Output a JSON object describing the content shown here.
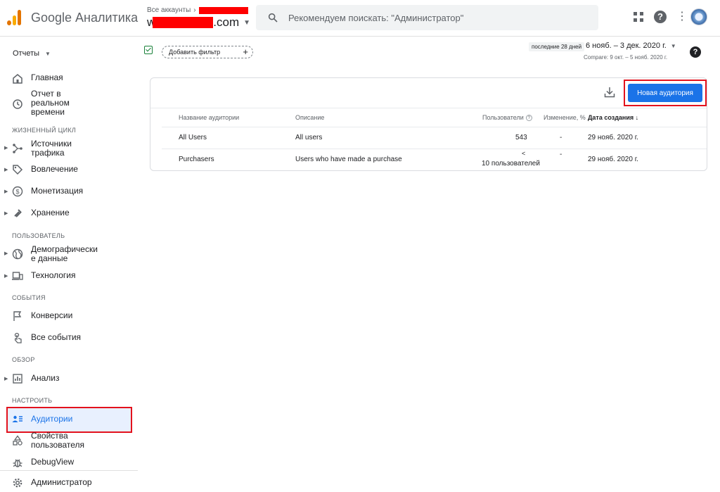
{
  "app": {
    "title": "Google Аналитика"
  },
  "account": {
    "breadcrumb": "Все аккаунты",
    "name_suffix": ".com"
  },
  "search": {
    "placeholder": "Рекомендуем поискать: \"Администратор\""
  },
  "sidebar": {
    "reports_label": "Отчеты",
    "items": {
      "home": "Главная",
      "realtime": "Отчет в реальном времени",
      "traffic": "Источники трафика",
      "engagement": "Вовлечение",
      "monetization": "Монетизация",
      "retention": "Хранение",
      "demographics": "Демографически е данные",
      "tech": "Технология",
      "conversions": "Конверсии",
      "all_events": "Все события",
      "analysis": "Анализ",
      "audiences": "Аудитории",
      "user_props": "Свойства пользователя",
      "debugview": "DebugView",
      "admin": "Администратор"
    },
    "sections": {
      "lifecycle": "ЖИЗНЕННЫЙ ЦИКЛ",
      "user": "ПОЛЬЗОВАТЕЛЬ",
      "events": "СОБЫТИЯ",
      "explore": "ОБЗОР",
      "configure": "НАСТРОИТЬ"
    }
  },
  "toolbar": {
    "add_filter": "Добавить фильтр",
    "date_tag": "последние 28 дней",
    "date_range": "6 нояб. – 3 дек. 2020 г.",
    "compare": "Compare: 9 окт. – 5 нояб. 2020 г."
  },
  "table": {
    "new_audience_button": "Новая аудитория",
    "headers": {
      "name": "Название аудитории",
      "description": "Описание",
      "users": "Пользователи",
      "change": "Изменение, %",
      "created": "Дата создания"
    },
    "rows": [
      {
        "name": "All Users",
        "description": "All users",
        "users": "543",
        "users_line2": "",
        "change": "-",
        "created": "29 нояб. 2020 г."
      },
      {
        "name": "Purchasers",
        "description": "Users who have made a purchase",
        "users": "<",
        "users_line2": "10 пользователей",
        "change": "-",
        "created": "29 нояб. 2020 г."
      }
    ]
  },
  "colors": {
    "accent": "#1a73e8",
    "highlight": "#e3121d",
    "active_bg": "#e8f0fe"
  }
}
